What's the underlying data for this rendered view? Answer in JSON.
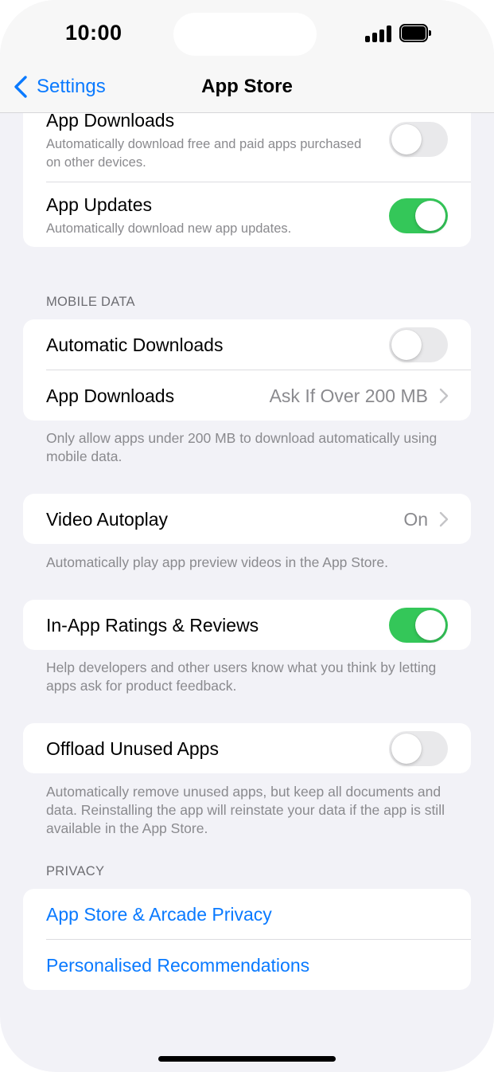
{
  "status_bar": {
    "time": "10:00"
  },
  "nav": {
    "back_label": "Settings",
    "title": "App Store"
  },
  "sections": {
    "automatic": {
      "app_downloads": {
        "label": "App Downloads",
        "subtitle": "Automatically download free and paid apps purchased on other devices.",
        "enabled": false
      },
      "app_updates": {
        "label": "App Updates",
        "subtitle": "Automatically download new app updates.",
        "enabled": true
      }
    },
    "mobile_data": {
      "header": "MOBILE DATA",
      "automatic_downloads": {
        "label": "Automatic Downloads",
        "enabled": false
      },
      "app_downloads": {
        "label": "App Downloads",
        "value": "Ask If Over 200 MB"
      },
      "footer": "Only allow apps under 200 MB to download automatically using mobile data."
    },
    "video": {
      "label": "Video Autoplay",
      "value": "On",
      "footer": "Automatically play app preview videos in the App Store."
    },
    "ratings": {
      "label": "In-App Ratings & Reviews",
      "enabled": true,
      "footer": "Help developers and other users know what you think by letting apps ask for product feedback."
    },
    "offload": {
      "label": "Offload Unused Apps",
      "enabled": false,
      "footer": "Automatically remove unused apps, but keep all documents and data. Reinstalling the app will reinstate your data if the app is still available in the App Store."
    },
    "privacy": {
      "header": "PRIVACY",
      "items": [
        {
          "label": "App Store & Arcade Privacy"
        },
        {
          "label": "Personalised Recommendations"
        }
      ]
    }
  },
  "colors": {
    "accent": "#0a7aff",
    "toggle_on": "#34c759",
    "toggle_off": "#e9e9eb",
    "background": "#f2f2f7"
  }
}
